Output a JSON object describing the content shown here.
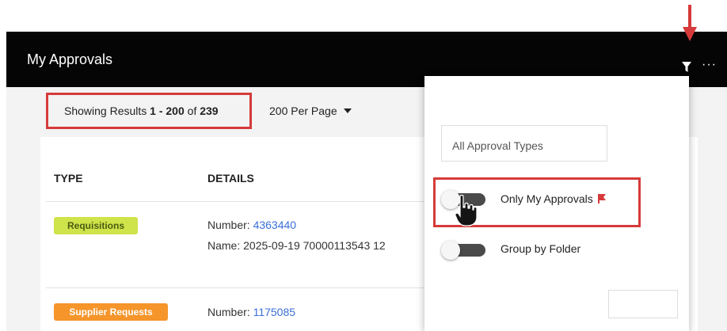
{
  "header": {
    "title": "My Approvals",
    "more_label": "···"
  },
  "results": {
    "prefix": "Showing Results ",
    "range": "1 - 200",
    "of_word": " of ",
    "total": "239"
  },
  "per_page": {
    "label": "200 Per Page"
  },
  "table": {
    "columns": [
      "TYPE",
      "DETAILS"
    ],
    "rows": [
      {
        "type_label": "Requisitions",
        "number_label": "Number: ",
        "number": "4363440",
        "name_line": "Name: 2025-09-19 70000113543 12"
      },
      {
        "type_label": "Supplier Requests",
        "number_label": "Number: ",
        "number": "1175085"
      }
    ]
  },
  "filter_panel": {
    "approval_type_value": "All Approval Types",
    "toggles": [
      {
        "label": "Only My Approvals",
        "on": false
      },
      {
        "label": "Group by Folder",
        "on": false
      }
    ]
  },
  "colors": {
    "header_bg": "#050505",
    "requisition_badge": "#cfe34a",
    "supplier_badge": "#f5952a",
    "link": "#3a6fd8",
    "annotation_red": "#d63a3a"
  },
  "icons": [
    "filter-icon",
    "more-icon",
    "flag-icon",
    "chevron-down-icon",
    "pointer-hand-icon",
    "arrow-down-icon"
  ]
}
